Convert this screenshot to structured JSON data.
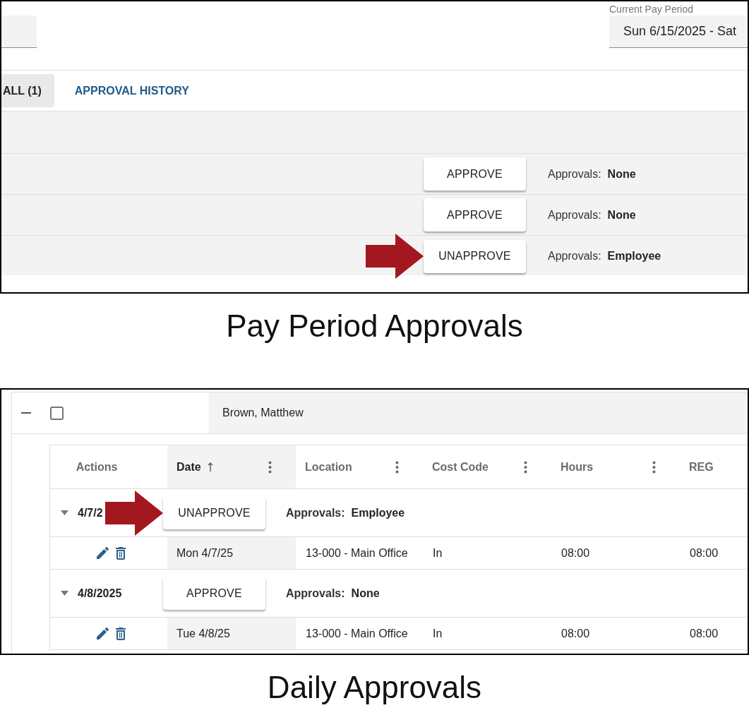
{
  "pay_period_view": {
    "pay_period": {
      "label": "Current Pay Period",
      "value": "Sun 6/15/2025 - Sat"
    },
    "tabs": [
      {
        "label": "ALL (1)",
        "selected": true
      },
      {
        "label": "APPROVAL HISTORY",
        "selected": false
      }
    ],
    "rows": [
      {
        "button": "APPROVE",
        "approvals_label": "Approvals:",
        "approvals": "None",
        "arrow": false
      },
      {
        "button": "APPROVE",
        "approvals_label": "Approvals:",
        "approvals": "None",
        "arrow": false
      },
      {
        "button": "UNAPPROVE",
        "approvals_label": "Approvals:",
        "approvals": "Employee",
        "arrow": true
      }
    ],
    "caption": "Pay Period Approvals"
  },
  "daily_view": {
    "employee": {
      "name": "Brown, Matthew",
      "expanded": true,
      "checked": false
    },
    "columns": [
      {
        "label": "Actions",
        "sorted": false,
        "menu": false
      },
      {
        "label": "Date",
        "sorted": true,
        "menu": true
      },
      {
        "label": "Location",
        "sorted": false,
        "menu": true
      },
      {
        "label": "Cost Code",
        "sorted": false,
        "menu": true
      },
      {
        "label": "Hours",
        "sorted": false,
        "menu": true
      },
      {
        "label": "REG",
        "sorted": false,
        "menu": false
      }
    ],
    "groups": [
      {
        "date": "4/7/2",
        "expanded": true,
        "button": "UNAPPROVE",
        "approvals_label": "Approvals:",
        "approvals": "Employee",
        "arrow": true,
        "entries": [
          {
            "cells": [
              "Mon 4/7/25",
              "13-000 - Main Office",
              "In",
              "08:00",
              "08:00"
            ]
          }
        ]
      },
      {
        "date": "4/8/2025",
        "expanded": true,
        "button": "APPROVE",
        "approvals_label": "Approvals:",
        "approvals": "None",
        "arrow": false,
        "entries": [
          {
            "cells": [
              "Tue 4/8/25",
              "13-000 - Main Office",
              "In",
              "08:00",
              "08:00"
            ]
          }
        ]
      }
    ],
    "caption": "Daily Approvals"
  }
}
